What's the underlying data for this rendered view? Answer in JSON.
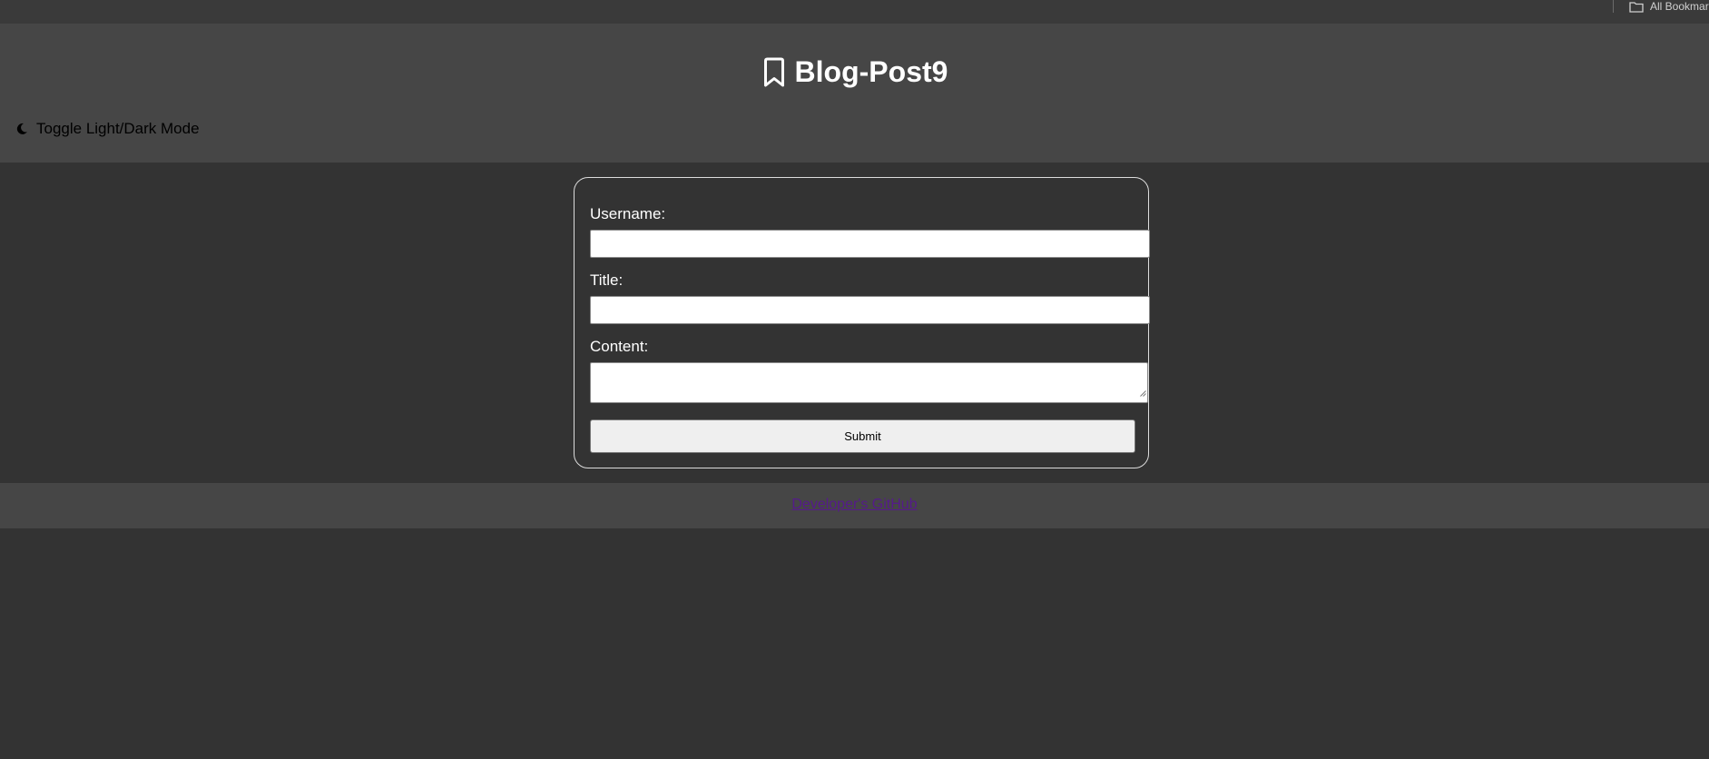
{
  "browser": {
    "bookmarks_label": "All Bookmarks"
  },
  "header": {
    "title": "Blog-Post9",
    "title_icon": "bookmark-icon",
    "theme_toggle_label": "Toggle Light/Dark Mode",
    "theme_toggle_icon": "moon-icon"
  },
  "form": {
    "username_label": "Username:",
    "username_value": "",
    "title_label": "Title:",
    "title_value": "",
    "content_label": "Content:",
    "content_value": "",
    "submit_label": "Submit"
  },
  "footer": {
    "link_label": "Developer's GitHub"
  },
  "colors": {
    "page_background": "#333333",
    "header_background": "#464646",
    "link_color": "#551a8b"
  }
}
